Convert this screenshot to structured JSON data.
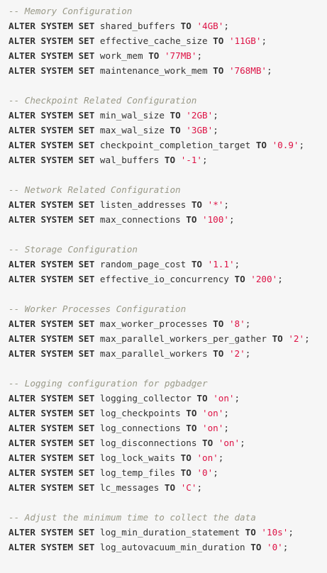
{
  "colors": {
    "background": "#f6f6f6",
    "text": "#333333",
    "comment": "#999988",
    "string": "#dd1144"
  },
  "code": {
    "sections": [
      {
        "comment": "-- Memory Configuration",
        "lines": [
          {
            "keyword": "ALTER SYSTEM SET",
            "param": "shared_buffers",
            "to": "TO",
            "value": "'4GB'",
            "end": ";"
          },
          {
            "keyword": "ALTER SYSTEM SET",
            "param": "effective_cache_size",
            "to": "TO",
            "value": "'11GB'",
            "end": ";"
          },
          {
            "keyword": "ALTER SYSTEM SET",
            "param": "work_mem",
            "to": "TO",
            "value": "'77MB'",
            "end": ";"
          },
          {
            "keyword": "ALTER SYSTEM SET",
            "param": "maintenance_work_mem",
            "to": "TO",
            "value": "'768MB'",
            "end": ";"
          }
        ]
      },
      {
        "comment": "-- Checkpoint Related Configuration",
        "lines": [
          {
            "keyword": "ALTER SYSTEM SET",
            "param": "min_wal_size",
            "to": "TO",
            "value": "'2GB'",
            "end": ";"
          },
          {
            "keyword": "ALTER SYSTEM SET",
            "param": "max_wal_size",
            "to": "TO",
            "value": "'3GB'",
            "end": ";"
          },
          {
            "keyword": "ALTER SYSTEM SET",
            "param": "checkpoint_completion_target",
            "to": "TO",
            "value": "'0.9'",
            "end": ";"
          },
          {
            "keyword": "ALTER SYSTEM SET",
            "param": "wal_buffers",
            "to": "TO",
            "value": "'-1'",
            "end": ";"
          }
        ]
      },
      {
        "comment": "-- Network Related Configuration",
        "lines": [
          {
            "keyword": "ALTER SYSTEM SET",
            "param": "listen_addresses",
            "to": "TO",
            "value": "'*'",
            "end": ";"
          },
          {
            "keyword": "ALTER SYSTEM SET",
            "param": "max_connections",
            "to": "TO",
            "value": "'100'",
            "end": ";"
          }
        ]
      },
      {
        "comment": "-- Storage Configuration",
        "lines": [
          {
            "keyword": "ALTER SYSTEM SET",
            "param": "random_page_cost",
            "to": "TO",
            "value": "'1.1'",
            "end": ";"
          },
          {
            "keyword": "ALTER SYSTEM SET",
            "param": "effective_io_concurrency",
            "to": "TO",
            "value": "'200'",
            "end": ";"
          }
        ]
      },
      {
        "comment": "-- Worker Processes Configuration",
        "lines": [
          {
            "keyword": "ALTER SYSTEM SET",
            "param": "max_worker_processes",
            "to": "TO",
            "value": "'8'",
            "end": ";"
          },
          {
            "keyword": "ALTER SYSTEM SET",
            "param": "max_parallel_workers_per_gather",
            "to": "TO",
            "value": "'2'",
            "end": ";"
          },
          {
            "keyword": "ALTER SYSTEM SET",
            "param": "max_parallel_workers",
            "to": "TO",
            "value": "'2'",
            "end": ";"
          }
        ]
      },
      {
        "comment": "-- Logging configuration for pgbadger",
        "lines": [
          {
            "keyword": "ALTER SYSTEM SET",
            "param": "logging_collector",
            "to": "TO",
            "value": "'on'",
            "end": ";"
          },
          {
            "keyword": "ALTER SYSTEM SET",
            "param": "log_checkpoints",
            "to": "TO",
            "value": "'on'",
            "end": ";"
          },
          {
            "keyword": "ALTER SYSTEM SET",
            "param": "log_connections",
            "to": "TO",
            "value": "'on'",
            "end": ";"
          },
          {
            "keyword": "ALTER SYSTEM SET",
            "param": "log_disconnections",
            "to": "TO",
            "value": "'on'",
            "end": ";"
          },
          {
            "keyword": "ALTER SYSTEM SET",
            "param": "log_lock_waits",
            "to": "TO",
            "value": "'on'",
            "end": ";"
          },
          {
            "keyword": "ALTER SYSTEM SET",
            "param": "log_temp_files",
            "to": "TO",
            "value": "'0'",
            "end": ";"
          },
          {
            "keyword": "ALTER SYSTEM SET",
            "param": "lc_messages",
            "to": "TO",
            "value": "'C'",
            "end": ";"
          }
        ]
      },
      {
        "comment": "-- Adjust the minimum time to collect the data",
        "lines": [
          {
            "keyword": "ALTER SYSTEM SET",
            "param": "log_min_duration_statement",
            "to": "TO",
            "value": "'10s'",
            "end": ";"
          },
          {
            "keyword": "ALTER SYSTEM SET",
            "param": "log_autovacuum_min_duration",
            "to": "TO",
            "value": "'0'",
            "end": ";"
          }
        ]
      }
    ]
  }
}
